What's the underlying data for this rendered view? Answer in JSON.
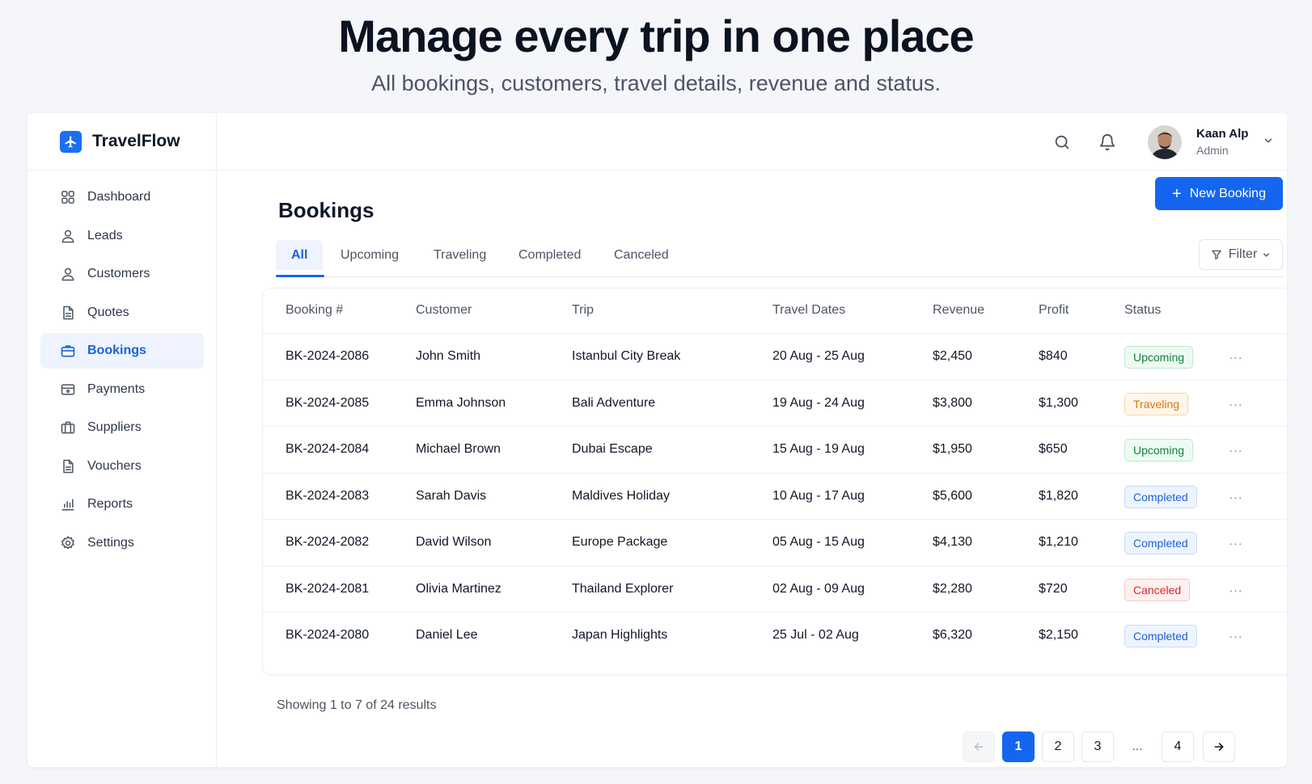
{
  "hero": {
    "title": "Manage every trip in one place",
    "subtitle": "All bookings, customers, travel details, revenue and status."
  },
  "brand": {
    "name": "TravelFlow",
    "accent": "#1466f0"
  },
  "sidebar": {
    "items": [
      {
        "label": "Dashboard",
        "icon": "grid-icon"
      },
      {
        "label": "Leads",
        "icon": "user-icon"
      },
      {
        "label": "Customers",
        "icon": "user-icon"
      },
      {
        "label": "Quotes",
        "icon": "document-icon"
      },
      {
        "label": "Bookings",
        "icon": "briefcase-icon",
        "active": true
      },
      {
        "label": "Payments",
        "icon": "wallet-icon"
      },
      {
        "label": "Suppliers",
        "icon": "luggage-icon"
      },
      {
        "label": "Vouchers",
        "icon": "document-icon"
      },
      {
        "label": "Reports",
        "icon": "bar-chart-icon"
      },
      {
        "label": "Settings",
        "icon": "gear-icon"
      }
    ]
  },
  "header": {
    "user": {
      "name": "Kaan Alp",
      "role": "Admin"
    }
  },
  "main": {
    "title": "Bookings",
    "new_button": "New Booking",
    "filter_label": "Filter",
    "tabs": [
      {
        "label": "All",
        "active": true
      },
      {
        "label": "Upcoming"
      },
      {
        "label": "Traveling"
      },
      {
        "label": "Completed"
      },
      {
        "label": "Canceled"
      }
    ]
  },
  "table": {
    "columns": [
      "Booking #",
      "Customer",
      "Trip",
      "Travel Dates",
      "Revenue",
      "Profit",
      "Status"
    ],
    "rows": [
      {
        "booking": "BK-2024-2086",
        "customer": "John Smith",
        "trip": "Istanbul City Break",
        "dates": "20 Aug - 25 Aug",
        "revenue": "$2,450",
        "profit": "$840",
        "status": "Upcoming"
      },
      {
        "booking": "BK-2024-2085",
        "customer": "Emma Johnson",
        "trip": "Bali Adventure",
        "dates": "19 Aug - 24 Aug",
        "revenue": "$3,800",
        "profit": "$1,300",
        "status": "Traveling"
      },
      {
        "booking": "BK-2024-2084",
        "customer": "Michael Brown",
        "trip": "Dubai Escape",
        "dates": "15 Aug - 19 Aug",
        "revenue": "$1,950",
        "profit": "$650",
        "status": "Upcoming"
      },
      {
        "booking": "BK-2024-2083",
        "customer": "Sarah Davis",
        "trip": "Maldives Holiday",
        "dates": "10 Aug - 17 Aug",
        "revenue": "$5,600",
        "profit": "$1,820",
        "status": "Completed"
      },
      {
        "booking": "BK-2024-2082",
        "customer": "David Wilson",
        "trip": "Europe Package",
        "dates": "05 Aug - 15 Aug",
        "revenue": "$4,130",
        "profit": "$1,210",
        "status": "Completed"
      },
      {
        "booking": "BK-2024-2081",
        "customer": "Olivia Martinez",
        "trip": "Thailand Explorer",
        "dates": "02 Aug - 09 Aug",
        "revenue": "$2,280",
        "profit": "$720",
        "status": "Canceled"
      },
      {
        "booking": "BK-2024-2080",
        "customer": "Daniel Lee",
        "trip": "Japan Highlights",
        "dates": "25 Jul - 02 Aug",
        "revenue": "$6,320",
        "profit": "$2,150",
        "status": "Completed"
      }
    ]
  },
  "pagination": {
    "summary": "Showing 1 to 7 of 24 results",
    "pages": [
      "1",
      "2",
      "3",
      "...",
      "4"
    ],
    "current": "1"
  }
}
